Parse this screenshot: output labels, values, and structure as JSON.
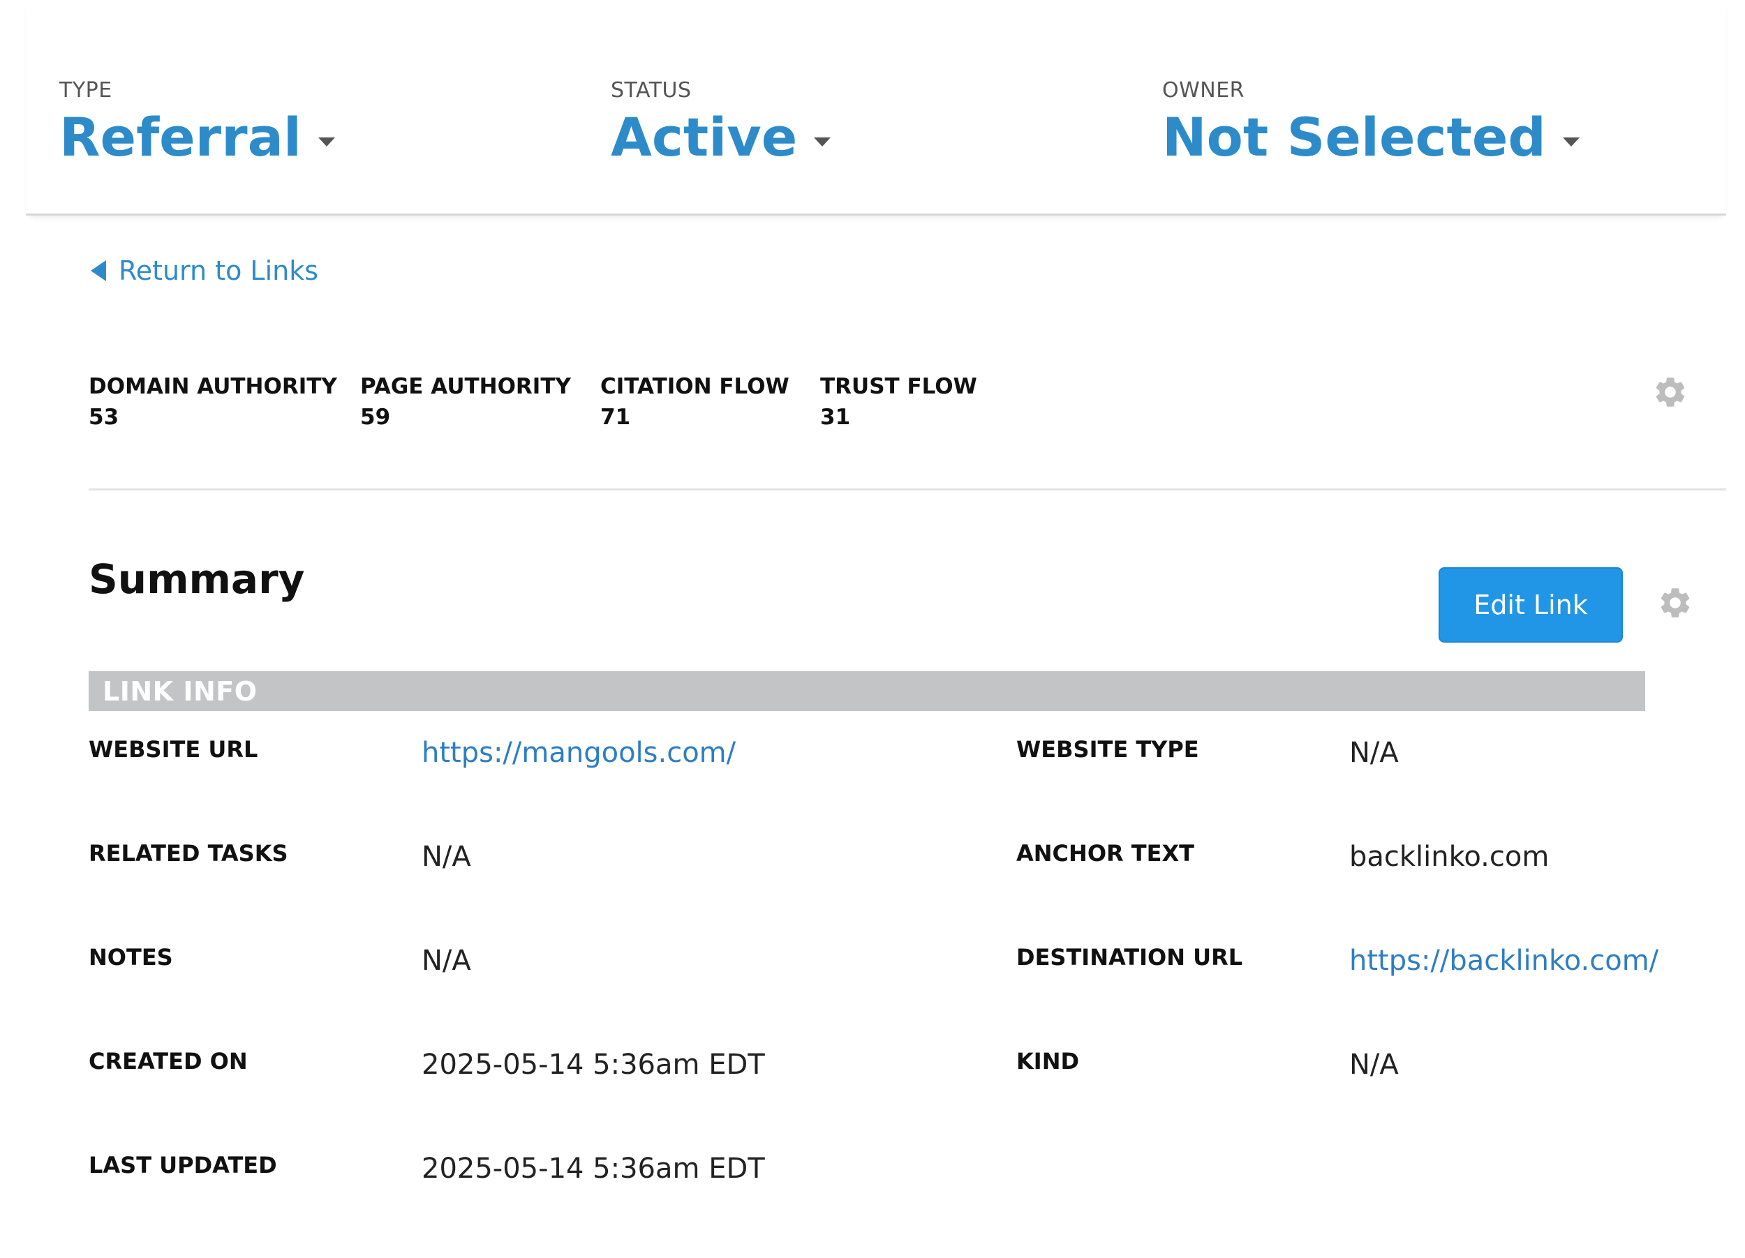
{
  "header": {
    "type": {
      "label": "TYPE",
      "value": "Referral"
    },
    "status": {
      "label": "STATUS",
      "value": "Active"
    },
    "owner": {
      "label": "OWNER",
      "value": "Not Selected"
    }
  },
  "navigation": {
    "return_label": "Return to Links"
  },
  "metrics": [
    {
      "label": "DOMAIN AUTHORITY",
      "value": "53"
    },
    {
      "label": "PAGE AUTHORITY",
      "value": "59"
    },
    {
      "label": "CITATION FLOW",
      "value": "71"
    },
    {
      "label": "TRUST FLOW",
      "value": "31"
    }
  ],
  "summary": {
    "title": "Summary",
    "edit_button_label": "Edit Link",
    "section_title": "LINK INFO",
    "left_fields": [
      {
        "label": "WEBSITE URL",
        "value": "https://mangools.com/"
      },
      {
        "label": "RELATED TASKS",
        "value": "N/A"
      },
      {
        "label": "NOTES",
        "value": "N/A"
      },
      {
        "label": "CREATED ON",
        "value": "2025-05-14 5:36am EDT"
      },
      {
        "label": "LAST UPDATED",
        "value": "2025-05-14 5:36am EDT"
      }
    ],
    "right_fields": [
      {
        "label": "WEBSITE TYPE",
        "value": "N/A"
      },
      {
        "label": "ANCHOR TEXT",
        "value": "backlinko.com"
      },
      {
        "label": "DESTINATION URL",
        "value": "https://backlinko.com/"
      },
      {
        "label": "KIND",
        "value": "N/A"
      }
    ]
  },
  "colors": {
    "accent": "#2e8bc9",
    "button": "#2196e6",
    "section_bar": "#c3c4c6",
    "link": "#2e7ec2"
  },
  "icons": {
    "settings": "gear-icon",
    "back": "triangle-left-icon",
    "dropdown": "caret-down-icon"
  }
}
